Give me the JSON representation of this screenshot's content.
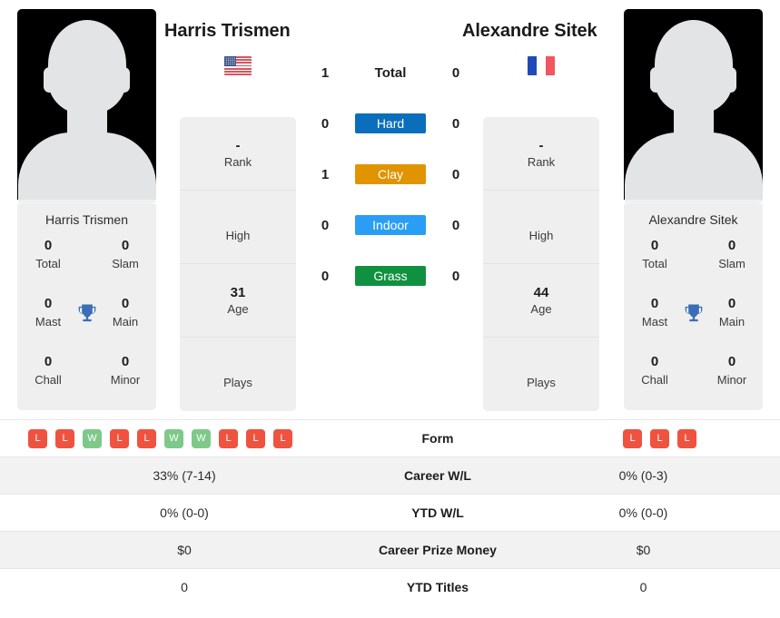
{
  "players": {
    "left": {
      "name": "Harris Trismen",
      "flag": "us-flag-icon",
      "photo": "player-photo-placeholder",
      "info": [
        {
          "value": "-",
          "label": "Rank"
        },
        {
          "value": "",
          "label": "High"
        },
        {
          "value": "31",
          "label": "Age"
        },
        {
          "value": "",
          "label": "Plays"
        }
      ],
      "titles": {
        "card_name": "Harris Trismen",
        "cells": [
          {
            "value": "0",
            "label": "Total"
          },
          {
            "value": "0",
            "label": "Slam"
          },
          {
            "value": "0",
            "label": "Mast"
          },
          {
            "value": "0",
            "label": "Main"
          },
          {
            "value": "0",
            "label": "Chall"
          },
          {
            "value": "0",
            "label": "Minor"
          }
        ]
      },
      "form": [
        "L",
        "L",
        "W",
        "L",
        "L",
        "W",
        "W",
        "L",
        "L",
        "L"
      ],
      "career_wl": "33% (7-14)",
      "ytd_wl": "0% (0-0)",
      "career_prize_money": "$0",
      "ytd_titles": "0"
    },
    "right": {
      "name": "Alexandre Sitek",
      "flag": "fr-flag-icon",
      "photo": "player-photo-placeholder",
      "info": [
        {
          "value": "-",
          "label": "Rank"
        },
        {
          "value": "",
          "label": "High"
        },
        {
          "value": "44",
          "label": "Age"
        },
        {
          "value": "",
          "label": "Plays"
        }
      ],
      "titles": {
        "card_name": "Alexandre Sitek",
        "cells": [
          {
            "value": "0",
            "label": "Total"
          },
          {
            "value": "0",
            "label": "Slam"
          },
          {
            "value": "0",
            "label": "Mast"
          },
          {
            "value": "0",
            "label": "Main"
          },
          {
            "value": "0",
            "label": "Chall"
          },
          {
            "value": "0",
            "label": "Minor"
          }
        ]
      },
      "form": [
        "L",
        "L",
        "L"
      ],
      "career_wl": "0% (0-3)",
      "ytd_wl": "0% (0-0)",
      "career_prize_money": "$0",
      "ytd_titles": "0"
    }
  },
  "h2h": {
    "rows": [
      {
        "left": "1",
        "label": "Total",
        "right": "0",
        "type": "total"
      },
      {
        "left": "0",
        "label": "Hard",
        "right": "0",
        "type": "badge",
        "color": "#0a6ebd"
      },
      {
        "left": "1",
        "label": "Clay",
        "right": "0",
        "type": "badge",
        "color": "#e09400"
      },
      {
        "left": "0",
        "label": "Indoor",
        "right": "0",
        "type": "badge",
        "color": "#2a9df4"
      },
      {
        "left": "0",
        "label": "Grass",
        "right": "0",
        "type": "badge",
        "color": "#109140"
      }
    ]
  },
  "table": {
    "rows": [
      {
        "label": "Form",
        "left": "",
        "right": "",
        "kind": "form"
      },
      {
        "label": "Career W/L",
        "left": "33% (7-14)",
        "right": "0% (0-3)",
        "kind": "text"
      },
      {
        "label": "YTD W/L",
        "left": "0% (0-0)",
        "right": "0% (0-0)",
        "kind": "text"
      },
      {
        "label": "Career Prize Money",
        "left": "$0",
        "right": "$0",
        "kind": "text"
      },
      {
        "label": "YTD Titles",
        "left": "0",
        "right": "0",
        "kind": "text"
      }
    ]
  },
  "colors": {
    "win": "#7ec98a",
    "loss": "#ef5340",
    "trophy": "#3a6eb5",
    "card_bg": "#efefef",
    "row_shade": "#f2f2f2"
  },
  "icons": {
    "trophy": "trophy-icon"
  }
}
